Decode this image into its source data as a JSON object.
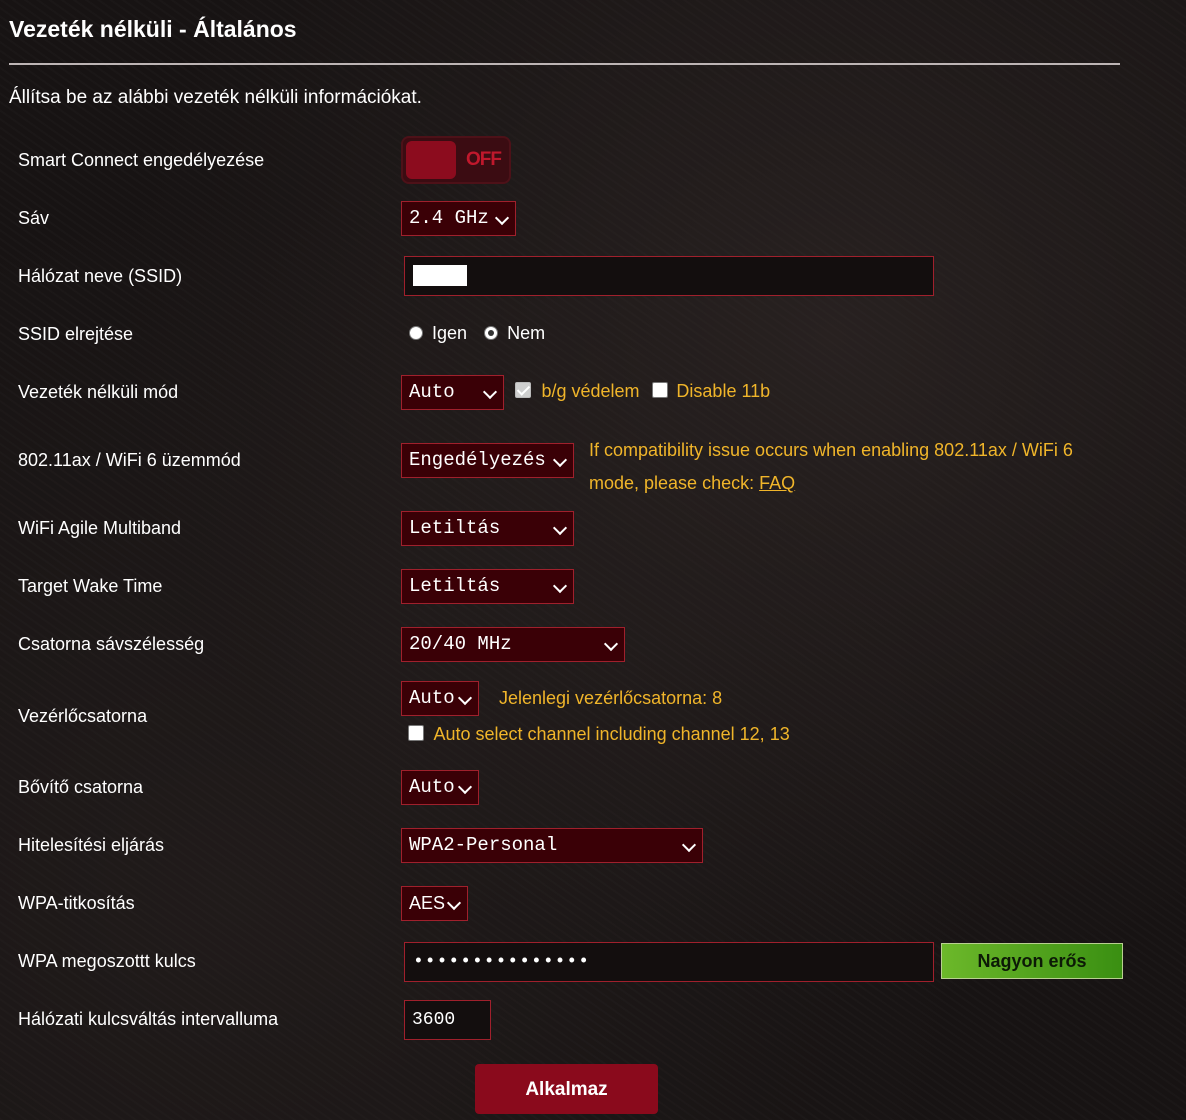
{
  "page": {
    "title": "Vezeték nélküli - Általános",
    "subtitle": "Állítsa be az alábbi vezeték nélküli információkat."
  },
  "labels": {
    "smart_connect": "Smart Connect engedélyezése",
    "band": "Sáv",
    "ssid": "Hálózat neve (SSID)",
    "hide_ssid": "SSID elrejtése",
    "wireless_mode": "Vezeték nélküli mód",
    "wifi6_mode": "802.11ax / WiFi 6 üzemmód",
    "agile_multiband": "WiFi Agile Multiband",
    "target_wake_time": "Target Wake Time",
    "channel_bandwidth": "Csatorna sávszélesség",
    "control_channel": "Vezérlőcsatorna",
    "extension_channel": "Bővítő csatorna",
    "auth_method": "Hitelesítési eljárás",
    "wpa_encryption": "WPA-titkosítás",
    "wpa_key": "WPA megoszottt kulcs",
    "key_rotation": "Hálózati kulcsváltás intervalluma"
  },
  "values": {
    "smart_connect_toggle": "OFF",
    "band": "2.4 GHz",
    "ssid_value": "",
    "hide_ssid_yes": "Igen",
    "hide_ssid_no": "Nem",
    "hide_ssid_selected": "Nem",
    "wireless_mode": "Auto",
    "bg_protection": "b/g védelem",
    "bg_protection_checked": true,
    "disable_11b": "Disable 11b",
    "disable_11b_checked": false,
    "wifi6_mode": "Engedélyezés",
    "wifi6_note": "If compatibility issue occurs when enabling 802.11ax / WiFi 6",
    "wifi6_note2": "mode, please check:",
    "faq_link": "FAQ",
    "agile_multiband": "Letiltás",
    "target_wake_time": "Letiltás",
    "channel_bandwidth": "20/40 MHz",
    "control_channel": "Auto",
    "current_channel": "Jelenlegi vezérlőcsatorna: 8",
    "auto_select_channel": "Auto select channel including channel 12, 13",
    "auto_select_checked": false,
    "extension_channel": "Auto",
    "auth_method": "WPA2-Personal",
    "wpa_encryption": "AES",
    "wpa_key": "•••••••••••••••",
    "key_strength": "Nagyon erős",
    "key_rotation": "3600"
  },
  "buttons": {
    "apply": "Alkalmaz"
  },
  "colors": {
    "accent_red": "#8a0a1c",
    "select_bg": "#3a0006",
    "highlight_yellow": "#f0b52a",
    "strength_green": "#5aaa22"
  }
}
